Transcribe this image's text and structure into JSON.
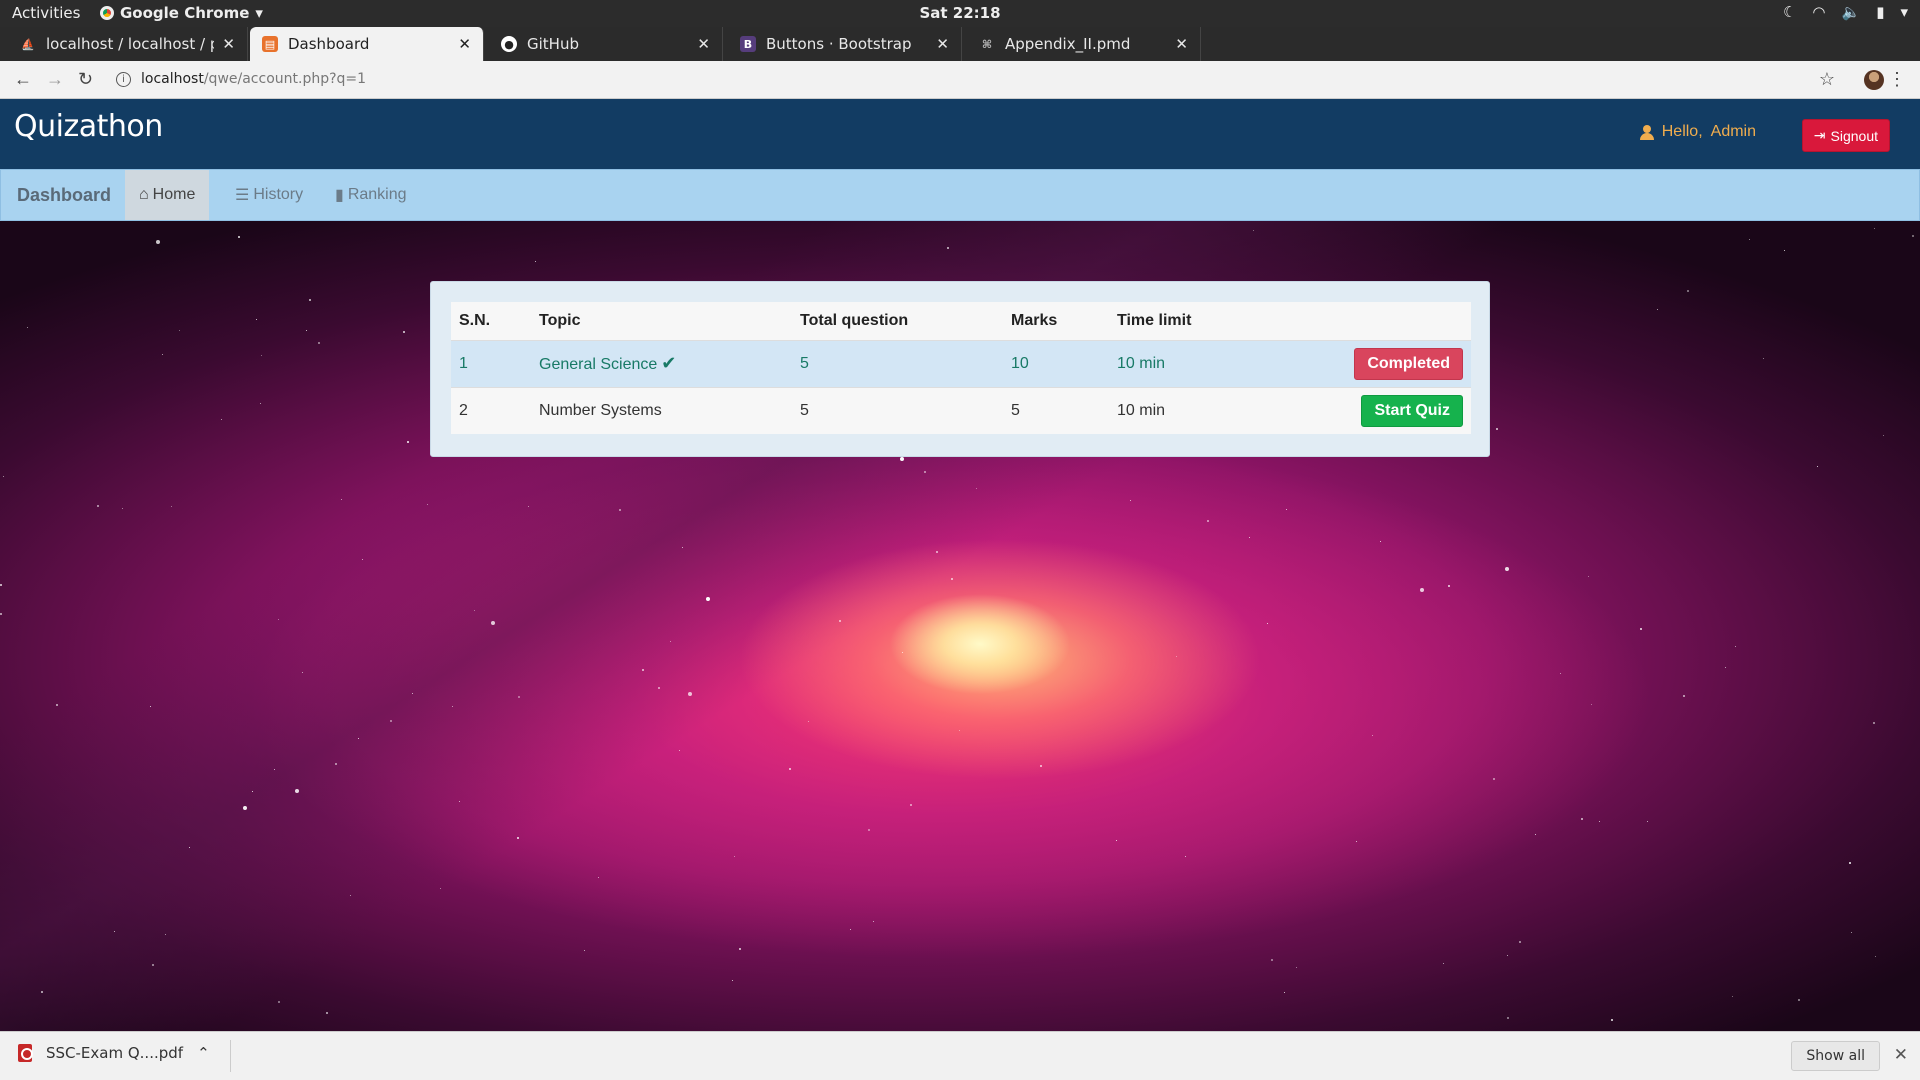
{
  "system_bar": {
    "activities": "Activities",
    "app_name": "Google Chrome",
    "clock": "Sat 22:18"
  },
  "tabs": [
    {
      "title": "localhost / localhost / pro",
      "active": false
    },
    {
      "title": "Dashboard",
      "active": true
    },
    {
      "title": "GitHub",
      "active": false
    },
    {
      "title": "Buttons · Bootstrap",
      "active": false
    },
    {
      "title": "Appendix_II.pmd",
      "active": false
    }
  ],
  "address_bar": {
    "host": "localhost",
    "path": "/qwe/account.php?q=1"
  },
  "header": {
    "brand": "Quizathon",
    "greeting": "Hello,",
    "user": "Admin",
    "signout_label": "Signout"
  },
  "nav": {
    "dashboard": "Dashboard",
    "home": "Home",
    "history": "History",
    "ranking": "Ranking"
  },
  "quiz_table": {
    "columns": [
      "S.N.",
      "Topic",
      "Total question",
      "Marks",
      "Time limit"
    ],
    "rows": [
      {
        "sn": "1",
        "topic": "General Science",
        "total": "5",
        "marks": "10",
        "time": "10 min",
        "action": "Completed"
      },
      {
        "sn": "2",
        "topic": "Number Systems",
        "total": "5",
        "marks": "5",
        "time": "10 min",
        "action": "Start Quiz"
      }
    ]
  },
  "downloads": {
    "file": "SSC-Exam Q....pdf",
    "show_all": "Show all"
  },
  "colors": {
    "header_bg": "#123c63",
    "nav_bg": "#a9d3f0",
    "signout": "#d9183b",
    "completed": "#d9455d",
    "start": "#16b24d",
    "greeting": "#f0ad4e"
  }
}
